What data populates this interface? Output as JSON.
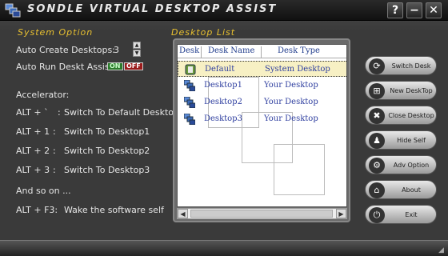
{
  "window": {
    "title": "Sondle Virtual Desktop Assist",
    "help": "?",
    "minimize": "−",
    "close": "✕"
  },
  "options": {
    "title": "System Option",
    "auto_create_label": "Auto Create Desktops:",
    "auto_create_value": "3",
    "auto_run_label": "Auto Run Deskt Assist:",
    "on_label": "ON",
    "off_label": "OFF",
    "accelerator_label": "Accelerator:",
    "shortcuts": [
      {
        "key": "ALT + `",
        "action": "Switch To Default Desktop"
      },
      {
        "key": "ALT + 1",
        "action": "Switch To Desktop1"
      },
      {
        "key": "ALT + 2",
        "action": "Switch To Desktop2"
      },
      {
        "key": "ALT + 3",
        "action": "Switch To Desktop3"
      }
    ],
    "and_so_on": "And so on ...",
    "wake_key": "ALT + F3:",
    "wake_action": "Wake the software self"
  },
  "desktop_list": {
    "title": "Desktop List",
    "columns": [
      "Desk",
      "Desk Name",
      "Desk Type"
    ],
    "rows": [
      {
        "name": "Default",
        "type": "System Desktop"
      },
      {
        "name": "Desktop1",
        "type": "Your Desktop"
      },
      {
        "name": "Desktop2",
        "type": "Your Desktop"
      },
      {
        "name": "Desktop3",
        "type": "Your Desktop"
      }
    ]
  },
  "actions": [
    {
      "label": "Switch Desk",
      "icon": "switch-icon"
    },
    {
      "label": "New DeskTop",
      "icon": "windows-icon"
    },
    {
      "label": "Close Desktop",
      "icon": "close-x-icon"
    },
    {
      "label": "Hide Self",
      "icon": "users-icon"
    },
    {
      "label": "Adv Option",
      "icon": "gear-icon"
    },
    {
      "label": "About",
      "icon": "home-icon"
    },
    {
      "label": "Exit",
      "icon": "power-icon"
    }
  ]
}
